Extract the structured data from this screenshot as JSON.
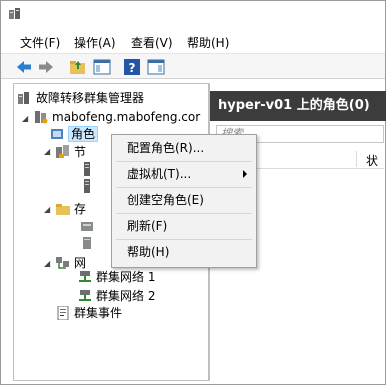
{
  "menu": {
    "file": "文件(F)",
    "action": "操作(A)",
    "view": "查看(V)",
    "help": "帮助(H)"
  },
  "tree": {
    "root": "故障转移群集管理器",
    "cluster": "mabofeng.mabofeng.cor",
    "roles": "角色",
    "nodes": "节",
    "storage": "存",
    "networks": "网",
    "network1": "群集网络 1",
    "network2": "群集网络 2",
    "events": "群集事件"
  },
  "right": {
    "header": "hyper-v01 上的角色(0)",
    "search_placeholder": "搜索",
    "col_partial": "状"
  },
  "context_menu": {
    "configure_role": "配置角色(R)...",
    "virtual_machines": "虚拟机(T)...",
    "create_empty_role": "创建空角色(E)",
    "refresh": "刷新(F)",
    "help": "帮助(H)"
  },
  "colors": {
    "header_bg": "#3c3c3c",
    "selection": "#cce8ff",
    "menu_bg": "#f2f2f2"
  }
}
